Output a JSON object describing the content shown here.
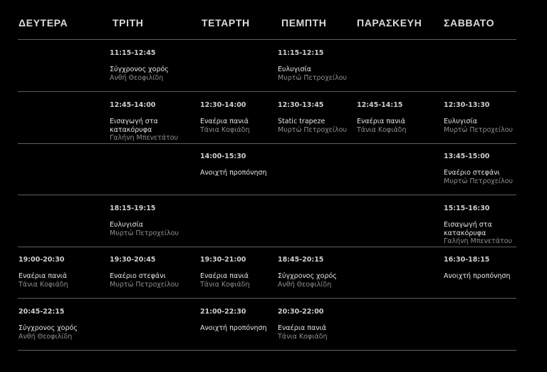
{
  "days": [
    "ΔΕΥΤΕΡΑ",
    "ΤΡΙΤΗ",
    "ΤΕΤΑΡΤΗ",
    "ΠΕΜΠΤΗ",
    "ΠΑΡΑΣΚΕΥΗ",
    "ΣΑΒΒΑΤΟ"
  ],
  "rows": [
    [
      null,
      {
        "time": "11:15-12:45",
        "class": "Σύγχρονος χορός",
        "instructor": "Ανθή Θεοφιλίδη"
      },
      null,
      {
        "time": "11:15-12:15",
        "class": "Ευλυγισία",
        "instructor": "Μυρτώ Πετροχείλου"
      },
      null,
      null
    ],
    [
      null,
      {
        "time": "12:45-14:00",
        "class": "Εισαγωγή στα κατακόρυφα",
        "instructor": "Γαλήνη Μπενετάτου"
      },
      {
        "time": "12:30-14:00",
        "class": "Εναέρια πανιά",
        "instructor": "Τάνια Κοφιάδη"
      },
      {
        "time": "12:30-13:45",
        "class": "Static trapeze",
        "instructor": "Μυρτώ Πετροχείλου"
      },
      {
        "time": "12:45-14:15",
        "class": "Εναέρια πανιά",
        "instructor": "Τάνια Κοφιάδη"
      },
      {
        "time": "12:30-13:30",
        "class": "Ευλυγισία",
        "instructor": "Μυρτώ Πετροχείλου"
      }
    ],
    [
      null,
      null,
      {
        "time": "14:00-15:30",
        "class": "Ανοιχτή προπόνηση",
        "instructor": ""
      },
      null,
      null,
      {
        "time": "13:45-15:00",
        "class": "Εναέριο στεφάνι",
        "instructor": "Μυρτώ Πετροχείλου"
      }
    ],
    [
      null,
      {
        "time": "18:15-19:15",
        "class": "Ευλυγισία",
        "instructor": "Μυρτώ Πετροχείλου"
      },
      null,
      null,
      null,
      {
        "time": "15:15-16:30",
        "class": "Εισαγωγή στα κατακόρυφα",
        "instructor": "Γαλήνη Μπενετάτου"
      }
    ],
    [
      {
        "time": "19:00-20:30",
        "class": "Εναέρια πανιά",
        "instructor": "Τάνια Κοφιάδη"
      },
      {
        "time": "19:30-20:45",
        "class": "Εναέριο στεφάνι",
        "instructor": "Μυρτώ Πετροχείλου"
      },
      {
        "time": "19:30-21:00",
        "class": "Εναέρια πανιά",
        "instructor": "Τάνια Κοφιάδη"
      },
      {
        "time": "18:45-20:15",
        "class": "Σύγχρονος χορός",
        "instructor": "Ανθή Θεοφιλίδη"
      },
      null,
      {
        "time": "16:30-18:15",
        "class": "Ανοιχτή προπόνηση",
        "instructor": ""
      }
    ],
    [
      {
        "time": "20:45-22:15",
        "class": "Σύγχρονος χορός",
        "instructor": "Ανθή Θεοφιλίδη"
      },
      null,
      {
        "time": "21:00-22:30",
        "class": "Ανοιχτή προπόνηση",
        "instructor": ""
      },
      {
        "time": "20:30-22:00",
        "class": "Εναέρια πανιά",
        "instructor": "Τάνια Κοφιάδη"
      },
      null,
      null
    ]
  ]
}
